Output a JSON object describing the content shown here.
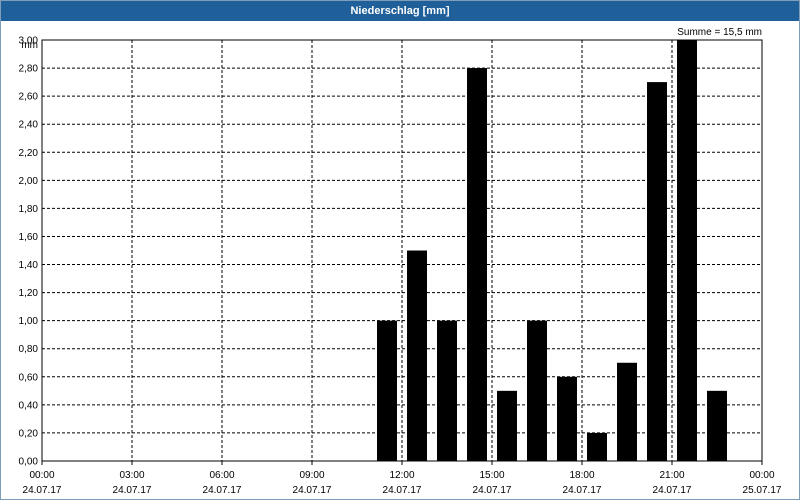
{
  "window": {
    "title": "Niederschlag [mm]"
  },
  "summary": "Summe = 15,5 mm",
  "chart_data": {
    "type": "bar",
    "title": "Niederschlag [mm]",
    "ylabel": "mm",
    "xlabel": "",
    "ylim": [
      0,
      3.0
    ],
    "yticks": [
      "0,00",
      "0,20",
      "0,40",
      "0,60",
      "0,80",
      "1,00",
      "1,20",
      "1,40",
      "1,60",
      "1,80",
      "2,00",
      "2,20",
      "2,40",
      "2,60",
      "2,80",
      "3,00"
    ],
    "xlim_hours": [
      0,
      24
    ],
    "xticks": [
      {
        "time": "00:00",
        "date": "24.07.17"
      },
      {
        "time": "03:00",
        "date": "24.07.17"
      },
      {
        "time": "06:00",
        "date": "24.07.17"
      },
      {
        "time": "09:00",
        "date": "24.07.17"
      },
      {
        "time": "12:00",
        "date": "24.07.17"
      },
      {
        "time": "15:00",
        "date": "24.07.17"
      },
      {
        "time": "18:00",
        "date": "24.07.17"
      },
      {
        "time": "21:00",
        "date": "24.07.17"
      },
      {
        "time": "00:00",
        "date": "25.07.17"
      }
    ],
    "categories": [
      "11:00",
      "12:00",
      "13:00",
      "14:00",
      "15:00",
      "16:00",
      "17:00",
      "18:00",
      "19:00",
      "20:00",
      "21:00",
      "22:00"
    ],
    "values": [
      1.0,
      1.5,
      1.0,
      2.8,
      0.5,
      1.0,
      0.6,
      0.2,
      0.7,
      2.7,
      3.0,
      0.5
    ],
    "bar_color": "#000000",
    "grid": true,
    "grid_style": "dashed",
    "sum": 15.5
  }
}
